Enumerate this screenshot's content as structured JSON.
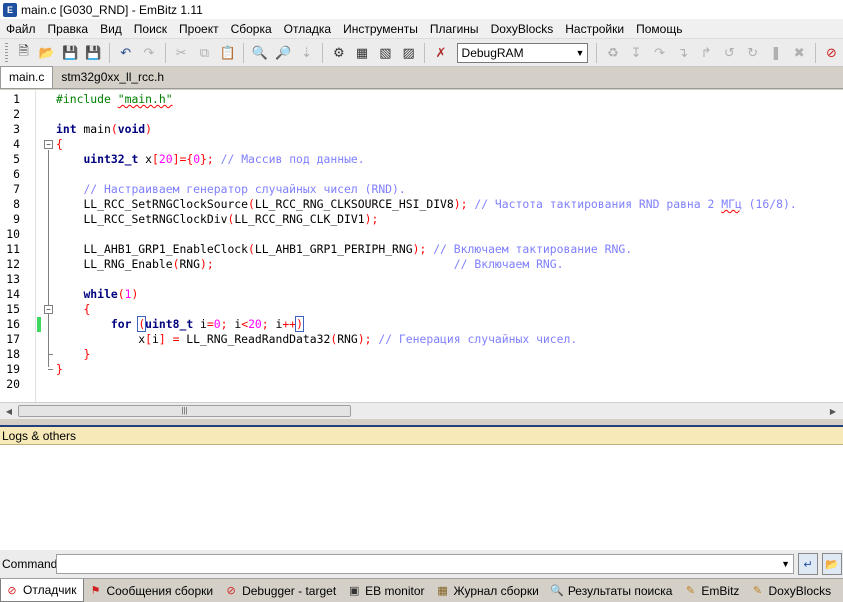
{
  "window": {
    "title": "main.c [G030_RND] - EmBitz 1.11"
  },
  "menu": [
    "Файл",
    "Правка",
    "Вид",
    "Поиск",
    "Проект",
    "Сборка",
    "Отладка",
    "Инструменты",
    "Плагины",
    "DoxyBlocks",
    "Настройки",
    "Помощь"
  ],
  "toolbar": {
    "build_target": "DebugRAM"
  },
  "editor_tabs": [
    {
      "label": "main.c",
      "active": true
    },
    {
      "label": "stm32g0xx_ll_rcc.h",
      "active": false
    }
  ],
  "code": {
    "l1_include": "#include ",
    "l1_file": "\"main.h\"",
    "l3_int": "int",
    "l3_main": " main",
    "l3_void": "void",
    "l5_type": "uint32_t",
    "l5_x": " x",
    "l5_20": "20",
    "l5_eq": "]={",
    "l5_0": "0",
    "l5_cm": " // Массив под данные.",
    "l7_cm": "// Настраиваем генератор случайных чисел (RND).",
    "l8_fn": "LL_RCC_SetRNGClockSource",
    "l8_arg": "LL_RCC_RNG_CLKSOURCE_HSI_DIV8",
    "l8_cm_a": " // Частота тактирования RND равна 2 ",
    "l8_cm_b": "МГц",
    "l8_cm_c": " (16/8).",
    "l9_fn": "LL_RCC_SetRNGClockDiv",
    "l9_arg": "LL_RCC_RNG_CLK_DIV1",
    "l11_fn": "LL_AHB1_GRP1_EnableClock",
    "l11_arg": "LL_AHB1_GRP1_PERIPH_RNG",
    "l11_cm": " // Включаем тактирование RNG.",
    "l12_fn": "LL_RNG_Enable",
    "l12_arg": "RNG",
    "l12_pad": "                                   ",
    "l12_cm": "// Включаем RNG.",
    "l14_kw": "while",
    "l14_1": "1",
    "l16_for": "for",
    "l16_type": "uint8_t",
    "l16_i": " i",
    "l16_0": "0",
    "l16_i2": " i",
    "l16_20": "20",
    "l16_i3": " i",
    "l17_x": "x",
    "l17_i": "i",
    "l17_fn": " LL_RNG_ReadRandData32",
    "l17_arg": "RNG",
    "l17_cm": " // Генерация случайных чисел."
  },
  "line_numbers": [
    "1",
    "2",
    "3",
    "4",
    "5",
    "6",
    "7",
    "8",
    "9",
    "10",
    "11",
    "12",
    "13",
    "14",
    "15",
    "16",
    "17",
    "18",
    "19",
    "20"
  ],
  "logs": {
    "title": "Logs & others"
  },
  "command": {
    "label": "Command:",
    "value": ""
  },
  "bottom_tabs": [
    {
      "label": "Отладчик",
      "icon": "stop-icon",
      "active": true
    },
    {
      "label": "Сообщения сборки",
      "icon": "flag-icon",
      "active": false
    },
    {
      "label": "Debugger - target",
      "icon": "stop-icon",
      "active": false
    },
    {
      "label": "EB monitor",
      "icon": "monitor-icon",
      "active": false
    },
    {
      "label": "Журнал сборки",
      "icon": "build-log-icon",
      "active": false
    },
    {
      "label": "Результаты поиска",
      "icon": "search-icon",
      "active": false
    },
    {
      "label": "EmBitz",
      "icon": "pencil-icon",
      "active": false
    },
    {
      "label": "DoxyBlocks",
      "icon": "pencil-icon",
      "active": false
    }
  ],
  "colors": {
    "keyword": "#00007f",
    "comment": "#7f7fff",
    "number": "#ff00ff",
    "operator": "#ff0000",
    "string": "#0000ff",
    "logs_header": "#f7e9b8"
  }
}
